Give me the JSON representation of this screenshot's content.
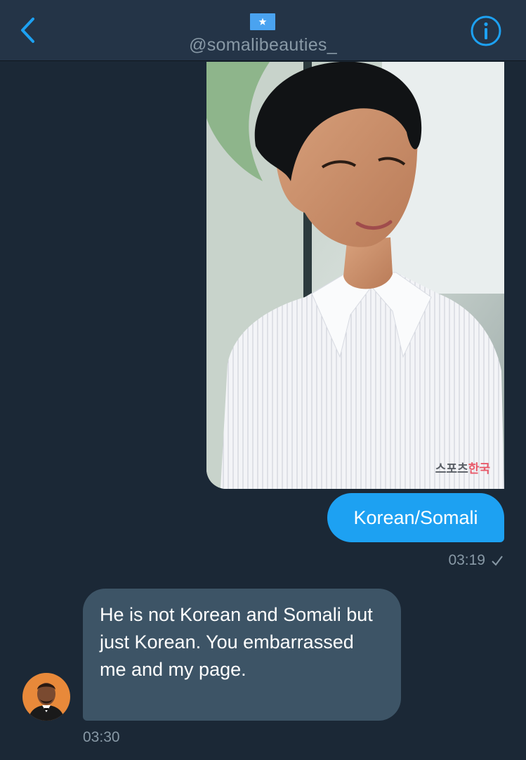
{
  "header": {
    "handle": "@somalibeauties_",
    "flag_icon": "somali-flag-icon",
    "back_icon": "chevron-left-icon",
    "info_icon": "info-circle-icon",
    "accent_color": "#1da1f2"
  },
  "messages": [
    {
      "direction": "outgoing",
      "image": "photo of a man in a white striped shirt",
      "image_watermark": {
        "part1": "스포츠",
        "part2": "한국"
      },
      "text": "Korean/Somali",
      "time": "03:19",
      "status_icon": "checkmark-icon"
    },
    {
      "direction": "incoming",
      "avatar_icon": "avatar-photo",
      "text": "He is not Korean and Somali but just Korean. You embarrassed me and my page.",
      "time": "03:30"
    }
  ],
  "colors": {
    "background": "#1b2836",
    "header": "#243447",
    "outgoing_bubble": "#1da1f2",
    "incoming_bubble": "#3d5466",
    "meta_text": "#8899a6"
  }
}
